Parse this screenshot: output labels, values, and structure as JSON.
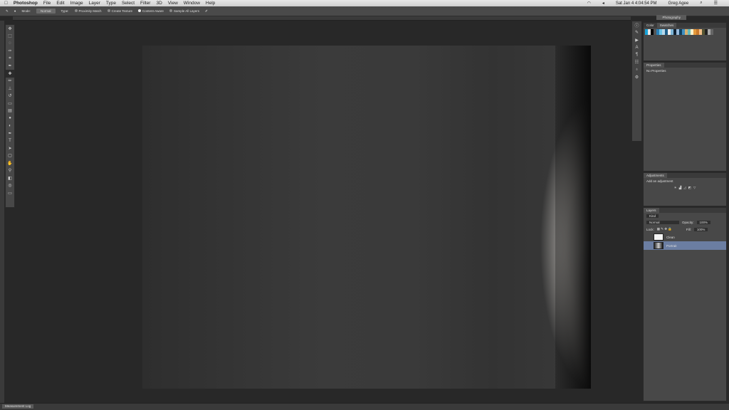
{
  "menubar": {
    "app": "Photoshop",
    "items": [
      "File",
      "Edit",
      "Image",
      "Layer",
      "Type",
      "Select",
      "Filter",
      "3D",
      "View",
      "Window",
      "Help"
    ],
    "clock": "Sat Jan 4  4:04:54 PM",
    "user": "Greg Agee"
  },
  "options": {
    "mode_label": "Mode:",
    "mode_value": "Normal",
    "type_label": "Type:",
    "proximity": "Proximity Match",
    "texture": "Create Texture",
    "content": "Content-Aware",
    "sample": "Sample All Layers",
    "workspace": "Photography"
  },
  "swatch_colors": [
    "#19a3d8",
    "#e6e6e6",
    "#000",
    "#555",
    "#2a7fb5",
    "#6ec6e8",
    "#b8d8ea",
    "#1f5f8a",
    "#f0f0f0",
    "#7cb4d6",
    "#123",
    "#9bd",
    "#0d3d5e",
    "#3f8fc0",
    "#d8b070",
    "#6bb",
    "#fff2cc",
    "#e59a3c",
    "#cc7a2a",
    "#f4c08a",
    "#553",
    "#222",
    "#aaa",
    "#666"
  ],
  "panels": {
    "color_tab": "Color",
    "swatches_tab": "Swatches",
    "properties_tab": "Properties",
    "no_properties": "No Properties",
    "adjustments_tab": "Adjustments",
    "add_adjustment": "Add an adjustment",
    "layers_tab": "Layers",
    "kind": "Kind",
    "blend": "Normal",
    "opacity_label": "Opacity:",
    "opacity": "100%",
    "lock_label": "Lock:",
    "fill_label": "Fill:",
    "fill": "100%"
  },
  "layers": [
    {
      "name": "Clean",
      "selected": false
    },
    {
      "name": "Portrait",
      "selected": true
    }
  ],
  "bottom": {
    "measurement_log": "Measurement Log"
  }
}
